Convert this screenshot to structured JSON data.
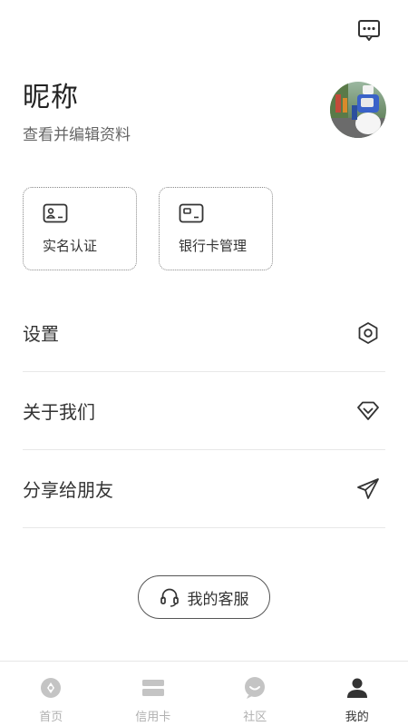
{
  "header": {
    "message_icon": "message-dots-icon"
  },
  "profile": {
    "nickname": "昵称",
    "subtitle": "查看并编辑资料",
    "avatar": "avatar-photo"
  },
  "cards": [
    {
      "label": "实名认证",
      "icon": "id-card-icon"
    },
    {
      "label": "银行卡管理",
      "icon": "bank-card-icon"
    }
  ],
  "menu": [
    {
      "label": "设置",
      "icon": "hexagon-settings-icon"
    },
    {
      "label": "关于我们",
      "icon": "diamond-icon"
    },
    {
      "label": "分享给朋友",
      "icon": "paper-plane-icon"
    }
  ],
  "service": {
    "label": "我的客服",
    "icon": "headset-icon"
  },
  "tabbar": {
    "items": [
      {
        "label": "首页",
        "icon": "home-compass-icon",
        "active": false
      },
      {
        "label": "信用卡",
        "icon": "credit-card-icon",
        "active": false
      },
      {
        "label": "社区",
        "icon": "community-chat-icon",
        "active": false
      },
      {
        "label": "我的",
        "icon": "person-icon",
        "active": true
      }
    ]
  },
  "colors": {
    "text": "#333333",
    "inactive": "#b0b0b0",
    "divider": "#e8e8e8"
  }
}
